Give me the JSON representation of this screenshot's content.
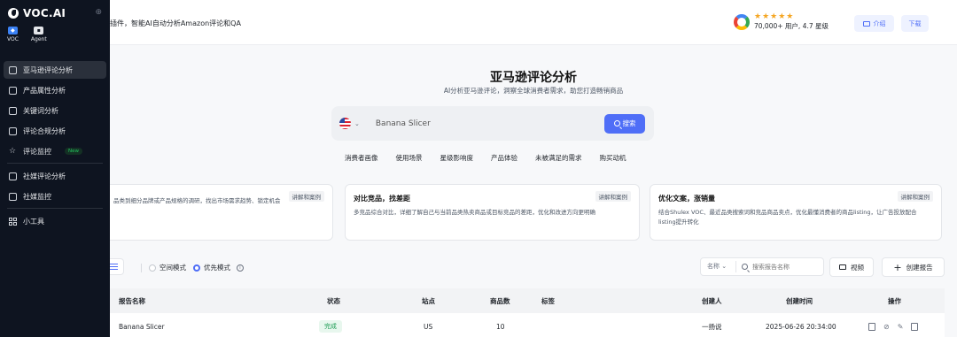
{
  "brand": {
    "name": "VOC.AI"
  },
  "modes": [
    {
      "label": "VOC"
    },
    {
      "label": "Agent"
    }
  ],
  "sidebar": {
    "items": [
      {
        "label": "亚马逊评论分析"
      },
      {
        "label": "产品属性分析"
      },
      {
        "label": "关键词分析"
      },
      {
        "label": "评论合规分析"
      },
      {
        "label": "评论监控",
        "badge": "New"
      },
      {
        "label": "社媒评论分析"
      },
      {
        "label": "社媒监控"
      },
      {
        "label": "小工具"
      }
    ]
  },
  "topbar": {
    "ticker": "插件，智能AI自动分析Amazon评论和QA",
    "stars": "★★★★★",
    "rating_text": "70,000+ 用户, 4.7 星级",
    "intro_label": "介绍",
    "download_label": "下载"
  },
  "hero": {
    "title": "亚马逊评论分析",
    "subtitle": "AI分析亚马逊评论，洞察全球消费者需求，助您打造畅销商品",
    "search_value": "Banana Slicer",
    "search_button": "搜索",
    "chips": [
      "消费者画像",
      "使用场景",
      "星级影响度",
      "产品体验",
      "未被满足的需求",
      "购买动机"
    ]
  },
  "cards": [
    {
      "title": "",
      "desc": "品类到细分品牌或产品规格的调研，找出市场需求趋势、锁定机会",
      "tag": "讲解和案例"
    },
    {
      "title": "对比竞品，找差距",
      "desc": "多竞品综合对比，详细了解自己与当前品类热卖商品或目标竞品的差距，优化和改进方向更明确",
      "tag": "讲解和案例"
    },
    {
      "title": "优化文案，涨销量",
      "desc": "结合Shulex VOC、最近品类搜索词和竞品商品卖点，优化最懂消费者的商品listing，让广告投放配合listing提升转化",
      "tag": "讲解和案例"
    }
  ],
  "toolbar": {
    "mode_space": "空间模式",
    "mode_priority": "优先模式",
    "filter_select": "名称",
    "filter_placeholder": "搜索报告名称",
    "video_label": "视频",
    "create_label": "创建报告"
  },
  "table": {
    "headers": {
      "name": "报告名称",
      "status": "状态",
      "site": "站点",
      "count": "商品数",
      "tags": "标签",
      "creator": "创建人",
      "created": "创建时间",
      "ops": "操作"
    },
    "rows": [
      {
        "name": "Banana Slicer",
        "status": "完成",
        "site": "US",
        "count": "10",
        "tags": "",
        "creator": "一扬说",
        "created": "2025-06-26 20:34:00"
      }
    ]
  },
  "colors": {
    "accent": "#4f6ef7",
    "sidebar_bg": "#0e1420",
    "success": "#1f9d55",
    "star": "#f5a623"
  }
}
